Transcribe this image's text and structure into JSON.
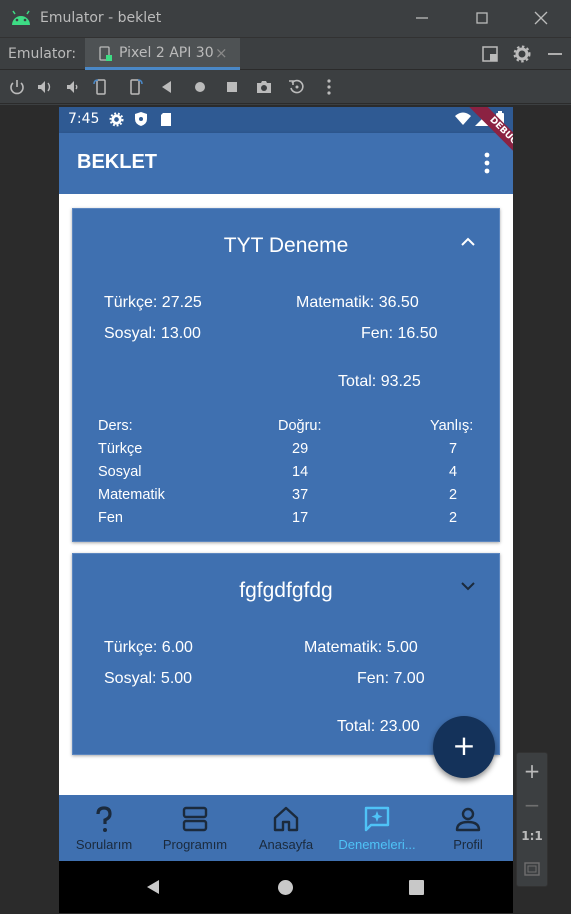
{
  "window": {
    "title": "Emulator - beklet"
  },
  "tabbar": {
    "label": "Emulator:",
    "tab_name": "Pixel 2 API 30",
    "tab_close": "×"
  },
  "statusbar": {
    "time": "7:45",
    "debug": "DEBUG"
  },
  "appbar": {
    "title": "BEKLET"
  },
  "cards": [
    {
      "title": "TYT Deneme",
      "turkce": "Türkçe: 27.25",
      "matematik": "Matematik: 36.50",
      "sosyal": "Sosyal: 13.00",
      "fen": "Fen: 16.50",
      "total": "Total: 93.25",
      "table": {
        "headers": [
          "Ders:",
          "Doğru:",
          "Yanlış:"
        ],
        "rows": [
          [
            "Türkçe",
            "29",
            "7"
          ],
          [
            "Sosyal",
            "14",
            "4"
          ],
          [
            "Matematik",
            "37",
            "2"
          ],
          [
            "Fen",
            "17",
            "2"
          ]
        ]
      }
    },
    {
      "title": "fgfgdfgfdg",
      "turkce": "Türkçe: 6.00",
      "matematik": "Matematik: 5.00",
      "sosyal": "Sosyal: 5.00",
      "fen": "Fen: 7.00",
      "total": "Total: 23.00"
    }
  ],
  "fab": {
    "label": "+"
  },
  "nav": {
    "items": [
      {
        "label": "Sorularım",
        "icon": "question-icon"
      },
      {
        "label": "Programım",
        "icon": "grid-icon"
      },
      {
        "label": "Anasayfa",
        "icon": "home-icon"
      },
      {
        "label": "Denemeleri...",
        "icon": "chat-sparkle-icon"
      },
      {
        "label": "Profil",
        "icon": "person-icon"
      }
    ]
  },
  "zoom": {
    "plus": "+",
    "minus": "−",
    "ratio": "1:1"
  },
  "colors": {
    "appbar": "#3f70b0",
    "statusbar": "#2f5a93",
    "fab": "#14325a",
    "active_nav": "#4fc3f7",
    "ide_bg": "#3c3f41"
  }
}
